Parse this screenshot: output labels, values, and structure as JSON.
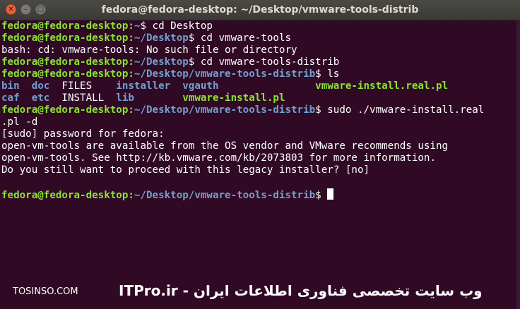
{
  "window": {
    "title": "fedora@fedora-desktop: ~/Desktop/vmware-tools-distrib"
  },
  "controls": {
    "close": "✕",
    "minimize": "–",
    "maximize": "□"
  },
  "colors": {
    "background": "#300a24",
    "prompt_user": "#8ae234",
    "prompt_path": "#729fcf",
    "text": "#ffffff"
  },
  "terminal": {
    "lines": [
      [
        {
          "t": "fedora@fedora-desktop:",
          "c": "g"
        },
        {
          "t": "~",
          "c": "b"
        },
        {
          "t": "$ cd Desktop",
          "c": "w"
        }
      ],
      [
        {
          "t": "fedora@fedora-desktop:",
          "c": "g"
        },
        {
          "t": "~/Desktop",
          "c": "b"
        },
        {
          "t": "$ cd vmware-tools",
          "c": "w"
        }
      ],
      [
        {
          "t": "bash: cd: vmware-tools: No such file or directory",
          "c": "w"
        }
      ],
      [
        {
          "t": "fedora@fedora-desktop:",
          "c": "g"
        },
        {
          "t": "~/Desktop",
          "c": "b"
        },
        {
          "t": "$ cd vmware-tools-distrib",
          "c": "w"
        }
      ],
      [
        {
          "t": "fedora@fedora-desktop:",
          "c": "g"
        },
        {
          "t": "~/Desktop/vmware-tools-distrib",
          "c": "b"
        },
        {
          "t": "$ ls",
          "c": "w"
        }
      ],
      [
        {
          "t": "bin  doc  ",
          "c": "b"
        },
        {
          "t": "FILES    ",
          "c": "w"
        },
        {
          "t": "installer  vgauth                ",
          "c": "b"
        },
        {
          "t": "vmware-install.real.pl",
          "c": "g"
        }
      ],
      [
        {
          "t": "caf  etc  ",
          "c": "b"
        },
        {
          "t": "INSTALL  ",
          "c": "w"
        },
        {
          "t": "lib        ",
          "c": "b"
        },
        {
          "t": "vmware-install.pl",
          "c": "g"
        }
      ],
      [
        {
          "t": "fedora@fedora-desktop:",
          "c": "g"
        },
        {
          "t": "~/Desktop/vmware-tools-distrib",
          "c": "b"
        },
        {
          "t": "$ sudo ./vmware-install.real",
          "c": "w"
        }
      ],
      [
        {
          "t": ".pl -d",
          "c": "w"
        }
      ],
      [
        {
          "t": "[sudo] password for fedora:",
          "c": "w"
        }
      ],
      [
        {
          "t": "open-vm-tools are available from the OS vendor and VMware recommends using",
          "c": "w"
        }
      ],
      [
        {
          "t": "open-vm-tools. See http://kb.vmware.com/kb/2073803 for more information.",
          "c": "w"
        }
      ],
      [
        {
          "t": "Do you still want to proceed with this legacy installer? [no]",
          "c": "w"
        }
      ],
      [
        {
          "t": "",
          "c": "w"
        }
      ],
      [
        {
          "t": "fedora@fedora-desktop:",
          "c": "g"
        },
        {
          "t": "~/Desktop/vmware-tools-distrib",
          "c": "b"
        },
        {
          "t": "$ ",
          "c": "w"
        }
      ]
    ]
  },
  "watermark": {
    "left": "TOSINSO.COM",
    "right": "ITPro.ir - وب سایت تخصصی فناوری اطلاعات ایران"
  }
}
